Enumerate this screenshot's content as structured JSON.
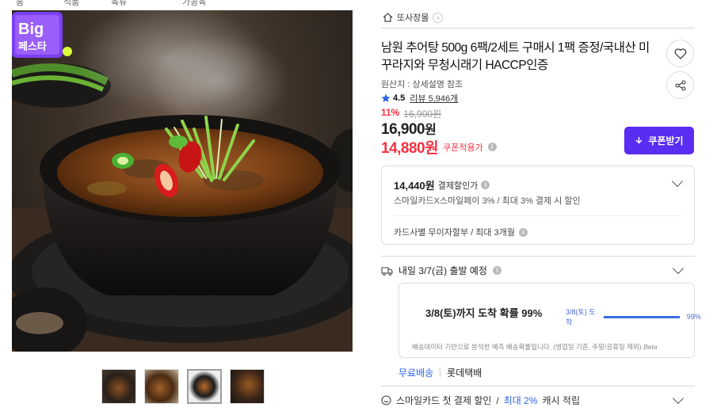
{
  "top_breadcrumb": [
    "홈",
    "식품",
    "육류",
    "가공육"
  ],
  "product_image": {
    "badge_line1": "Big",
    "badge_line2": "페스타"
  },
  "thumbnails_count": 4,
  "store": {
    "name": "또사장몰"
  },
  "product": {
    "title": "남원 추어탕 500g 6팩/2세트 구매시 1팩 증정/국내산 미꾸라지와 무청시래기 HACCP인증",
    "origin": "원산지 : 상세설명 참조",
    "rating": "4.5",
    "review_label": "리뷰 5,946개",
    "discount_pct": "11%",
    "original_price": "16,900원",
    "price_value": "16,900",
    "price_unit": "원",
    "coupon_price": "14,880원",
    "coupon_applied_label": "쿠폰적용가",
    "coupon_button": "쿠폰받기"
  },
  "card_discount": {
    "price": "14,440원",
    "label": "결제할인가",
    "desc": "스마일카드X스마일페이 3% / 최대 3% 결제 시 할인",
    "installment": "카드사별 무이자할부 / 최대 3개월"
  },
  "shipping": {
    "departure": "내일 3/7(금) 출발 예정",
    "arrival_prob": "3/8(토)까지 도착 확률 99%",
    "mini_label": "3/8(토) 도착",
    "mini_pct": "99%",
    "progress": 0.99,
    "note": "배송데이터 기반으로 분석한 예측 배송확률입니다. (영업일 기준, 주말/공휴일 제외)",
    "beta": "Beta",
    "free": "무료배송",
    "carrier": "롯데택배"
  },
  "smile": {
    "text1": "스마일카드 첫 결제 할인",
    "slash": "/",
    "text2": "최대 2%",
    "text3": "캐시 적립"
  },
  "colors": {
    "accent": "#5b2cf1",
    "sale": "#f43142",
    "link": "#2c66e8"
  }
}
